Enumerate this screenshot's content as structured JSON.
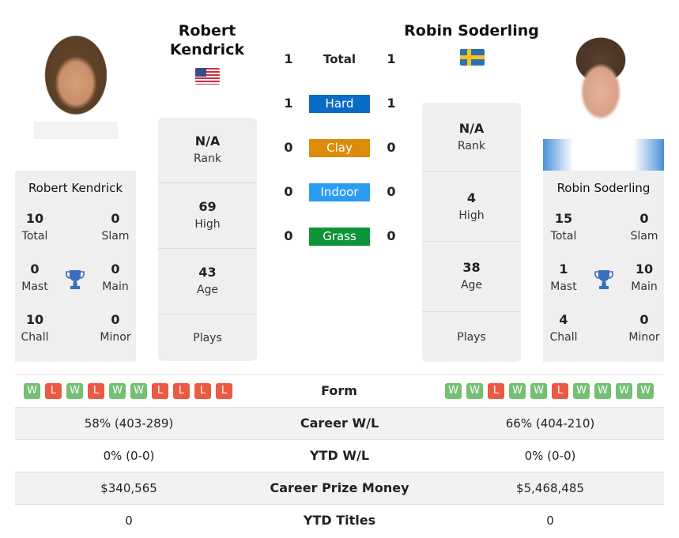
{
  "player_left": {
    "name": "Robert Kendrick",
    "name_heading_line1": "Robert",
    "name_heading_line2": "Kendrick",
    "country_flag": "us-flag",
    "rank": {
      "value": "N/A",
      "label": "Rank"
    },
    "high": {
      "value": "69",
      "label": "High"
    },
    "age": {
      "value": "43",
      "label": "Age"
    },
    "plays": {
      "value": "",
      "label": "Plays"
    },
    "titles": {
      "total": {
        "value": "10",
        "label": "Total"
      },
      "slam": {
        "value": "0",
        "label": "Slam"
      },
      "mast": {
        "value": "0",
        "label": "Mast"
      },
      "main": {
        "value": "0",
        "label": "Main"
      },
      "chall": {
        "value": "10",
        "label": "Chall"
      },
      "minor": {
        "value": "0",
        "label": "Minor"
      }
    },
    "form": [
      "W",
      "L",
      "W",
      "L",
      "W",
      "W",
      "L",
      "L",
      "L",
      "L"
    ]
  },
  "player_right": {
    "name": "Robin Soderling",
    "name_heading": "Robin Soderling",
    "country_flag": "se-flag",
    "rank": {
      "value": "N/A",
      "label": "Rank"
    },
    "high": {
      "value": "4",
      "label": "High"
    },
    "age": {
      "value": "38",
      "label": "Age"
    },
    "plays": {
      "value": "",
      "label": "Plays"
    },
    "titles": {
      "total": {
        "value": "15",
        "label": "Total"
      },
      "slam": {
        "value": "0",
        "label": "Slam"
      },
      "mast": {
        "value": "1",
        "label": "Mast"
      },
      "main": {
        "value": "10",
        "label": "Main"
      },
      "chall": {
        "value": "4",
        "label": "Chall"
      },
      "minor": {
        "value": "0",
        "label": "Minor"
      }
    },
    "form": [
      "W",
      "W",
      "L",
      "W",
      "W",
      "L",
      "W",
      "W",
      "W",
      "W"
    ]
  },
  "h2h": [
    {
      "label": "Total",
      "left": "1",
      "right": "1",
      "color": ""
    },
    {
      "label": "Hard",
      "left": "1",
      "right": "1",
      "color": "#0a6cc4"
    },
    {
      "label": "Clay",
      "left": "0",
      "right": "0",
      "color": "#dc8c0a"
    },
    {
      "label": "Indoor",
      "left": "0",
      "right": "0",
      "color": "#2a9cf2"
    },
    {
      "label": "Grass",
      "left": "0",
      "right": "0",
      "color": "#0c9438"
    }
  ],
  "form_label": "Form",
  "stats": [
    {
      "label": "Career W/L",
      "left": "58% (403-289)",
      "right": "66% (404-210)"
    },
    {
      "label": "YTD W/L",
      "left": "0% (0-0)",
      "right": "0% (0-0)"
    },
    {
      "label": "Career Prize Money",
      "left": "$340,565",
      "right": "$5,468,485"
    },
    {
      "label": "YTD Titles",
      "left": "0",
      "right": "0"
    }
  ],
  "icons": {
    "trophy": "trophy-icon",
    "trophy_color": "#3a6fc0"
  }
}
